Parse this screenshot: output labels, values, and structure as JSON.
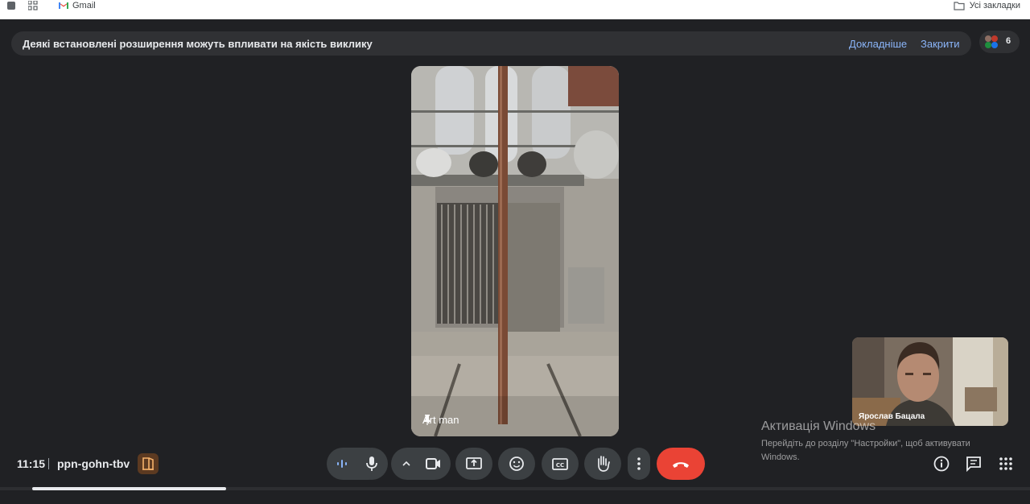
{
  "browser": {
    "gmail_label": "Gmail",
    "all_bookmarks_label": "Усі закладки"
  },
  "banner": {
    "message": "Деякі встановлені розширення можуть впливати на якість виклику",
    "learn_more": "Докладніше",
    "close": "Закрити"
  },
  "participants": {
    "count": "6"
  },
  "main_video": {
    "name": "Art man",
    "pinned": true
  },
  "self_view": {
    "name": "Ярослав Бацала"
  },
  "windows_activation": {
    "title": "Активація Windows",
    "message": "Перейдіть до розділу \"Настройки\", щоб активувати Windows."
  },
  "meeting": {
    "time": "11:15",
    "code": "ppn-gohn-tbv"
  },
  "controls": {
    "microphone": "mic-icon",
    "camera": "camera-icon",
    "present": "present-screen-icon",
    "reactions": "emoji-icon",
    "captions": "closed-captions-icon",
    "raise_hand": "hand-icon",
    "more": "more-vertical-icon",
    "leave": "end-call-icon",
    "end_call_color": "#ea4335"
  },
  "right_controls": {
    "info": "info-icon",
    "chat": "chat-icon",
    "activities": "apps-grid-icon"
  }
}
